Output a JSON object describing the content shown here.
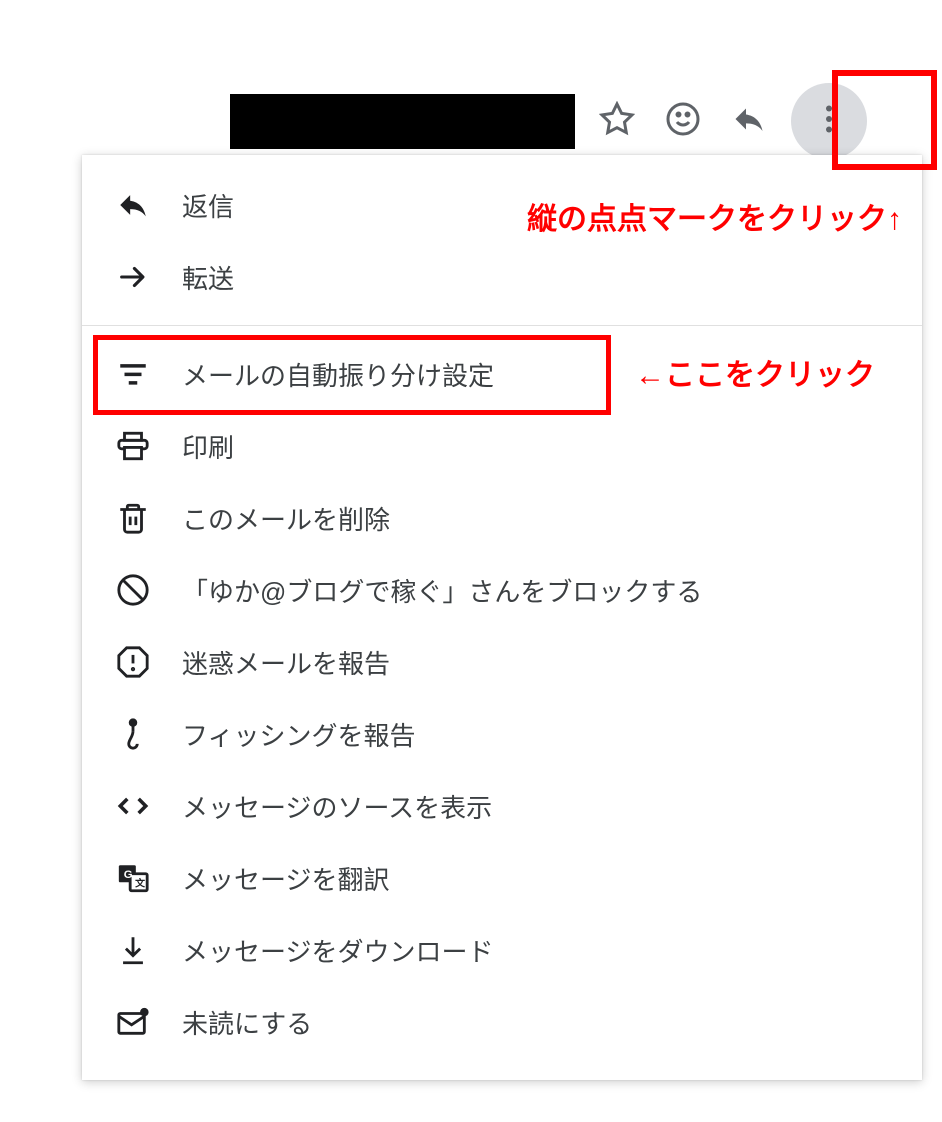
{
  "annotations": {
    "top": "縦の点点マークをクリック↑",
    "side": "←ここをクリック"
  },
  "menu": {
    "reply": "返信",
    "forward": "転送",
    "filter": "メールの自動振り分け設定",
    "print": "印刷",
    "delete": "このメールを削除",
    "block": "「ゆか@ブログで稼ぐ」さんをブロックする",
    "spam": "迷惑メールを報告",
    "phishing": "フィッシングを報告",
    "source": "メッセージのソースを表示",
    "translate": "メッセージを翻訳",
    "download": "メッセージをダウンロード",
    "unread": "未読にする"
  }
}
